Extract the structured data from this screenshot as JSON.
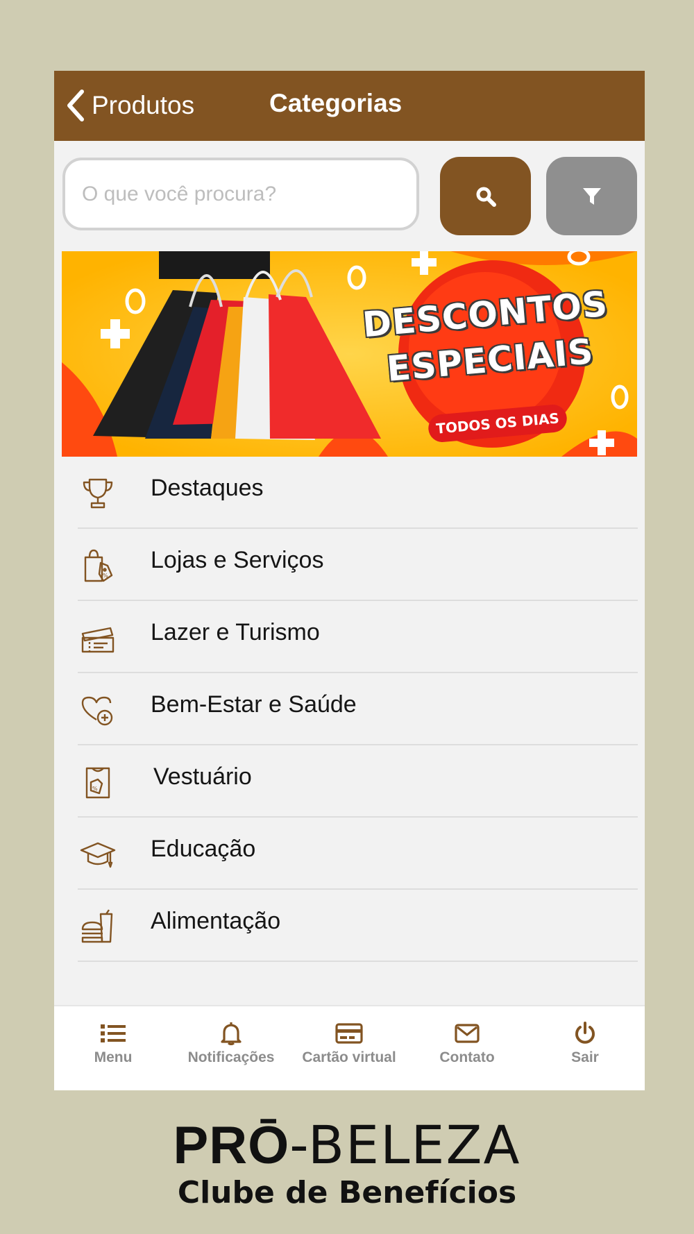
{
  "header": {
    "back_label": "Produtos",
    "title": "Categorias"
  },
  "search": {
    "placeholder": "O que você procura?"
  },
  "banner": {
    "line1": "DESCONTOS",
    "line2": "ESPECIAIS",
    "tagline": "TODOS OS DIAS"
  },
  "categories": [
    {
      "label": "Destaques",
      "icon": "trophy-icon"
    },
    {
      "label": "Lojas e Serviços",
      "icon": "shopping-bag-icon"
    },
    {
      "label": "Lazer e Turismo",
      "icon": "ticket-icon"
    },
    {
      "label": "Bem-Estar e Saúde",
      "icon": "heart-plus-icon"
    },
    {
      "label": "Vestuário",
      "icon": "clothing-tag-icon"
    },
    {
      "label": "Educação",
      "icon": "graduation-cap-icon"
    },
    {
      "label": "Alimentação",
      "icon": "burger-drink-icon"
    }
  ],
  "bottom_nav": [
    {
      "label": "Menu",
      "icon": "list-icon"
    },
    {
      "label": "Notificações",
      "icon": "bell-icon"
    },
    {
      "label": "Cartão virtual",
      "icon": "credit-card-icon"
    },
    {
      "label": "Contato",
      "icon": "envelope-icon"
    },
    {
      "label": "Sair",
      "icon": "power-icon"
    }
  ],
  "brand": {
    "name_bold": "PRŌ",
    "name_light": "-BELEZA",
    "subtitle": "Clube de Benefícios"
  },
  "colors": {
    "primary_brown": "#825422",
    "filter_gray": "#8f8f8f",
    "page_background": "#cfccb2",
    "nav_label_gray": "#8c8c8c"
  }
}
